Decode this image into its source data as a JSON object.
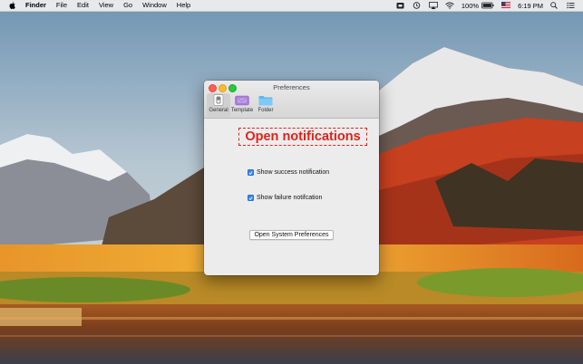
{
  "menubar": {
    "apple_icon": "apple-logo-icon",
    "app_name": "Finder",
    "menus": [
      "File",
      "Edit",
      "View",
      "Go",
      "Window",
      "Help"
    ],
    "battery": "100%",
    "time": "6:19 PM",
    "status_icons": [
      "app-status-icon",
      "time-machine-icon",
      "airplay-icon",
      "wifi-icon",
      "battery-icon",
      "us-flag-input-icon",
      "spotlight-icon",
      "notification-center-icon"
    ]
  },
  "window": {
    "title": "Preferences",
    "toolbar": [
      {
        "label": "General",
        "icon": "general-switch-icon",
        "selected": true
      },
      {
        "label": "Template",
        "icon": "template-icon",
        "selected": false
      },
      {
        "label": "Folder",
        "icon": "folder-icon",
        "selected": false
      }
    ],
    "open_notifications": "Open notifications",
    "checkboxes": [
      {
        "label": "Show success notification",
        "checked": true
      },
      {
        "label": "Show failure notifcation",
        "checked": true
      }
    ],
    "open_system_prefs": "Open System Preferences"
  },
  "colors": {
    "accent_red": "#e0221c",
    "checkbox_blue": "#3a87f0",
    "menubar_bg": "#eeeeee"
  }
}
